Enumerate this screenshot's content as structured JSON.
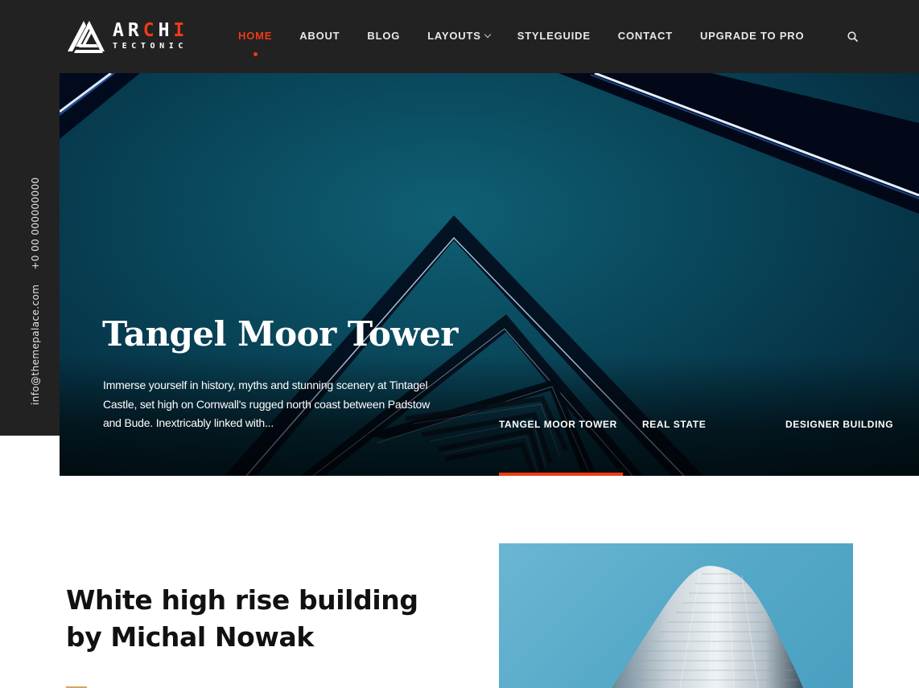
{
  "brand": {
    "name_part1": "AR",
    "name_accent1": "C",
    "name_part2": "H",
    "name_accent2": "I",
    "tagline": "TECTONIC"
  },
  "nav": {
    "items": [
      {
        "label": "HOME",
        "active": true
      },
      {
        "label": "ABOUT"
      },
      {
        "label": "BLOG"
      },
      {
        "label": "LAYOUTS",
        "has_dropdown": true
      },
      {
        "label": "STYLEGUIDE"
      },
      {
        "label": "CONTACT"
      },
      {
        "label": "UPGRADE TO PRO"
      }
    ],
    "search_icon": "search-icon"
  },
  "sidebar": {
    "email": "info@themepalace.com",
    "phone": "+0 00 000000000"
  },
  "hero": {
    "title": "Tangel Moor Tower",
    "description": "Immerse yourself in history, myths and stunning scenery at Tintagel Castle, set high on Cornwall's rugged north coast between Padstow and Bude. Inextricably linked with...",
    "slides": [
      {
        "label": "TANGEL MOOR TOWER",
        "active": true
      },
      {
        "label": "REAL STATE"
      },
      {
        "label": "DESIGNER BUILDING"
      }
    ]
  },
  "feature": {
    "title": "White high rise building by Michal Nowak"
  },
  "colors": {
    "accent": "#f03a17",
    "dark": "#222222",
    "gold": "#d6a363"
  }
}
